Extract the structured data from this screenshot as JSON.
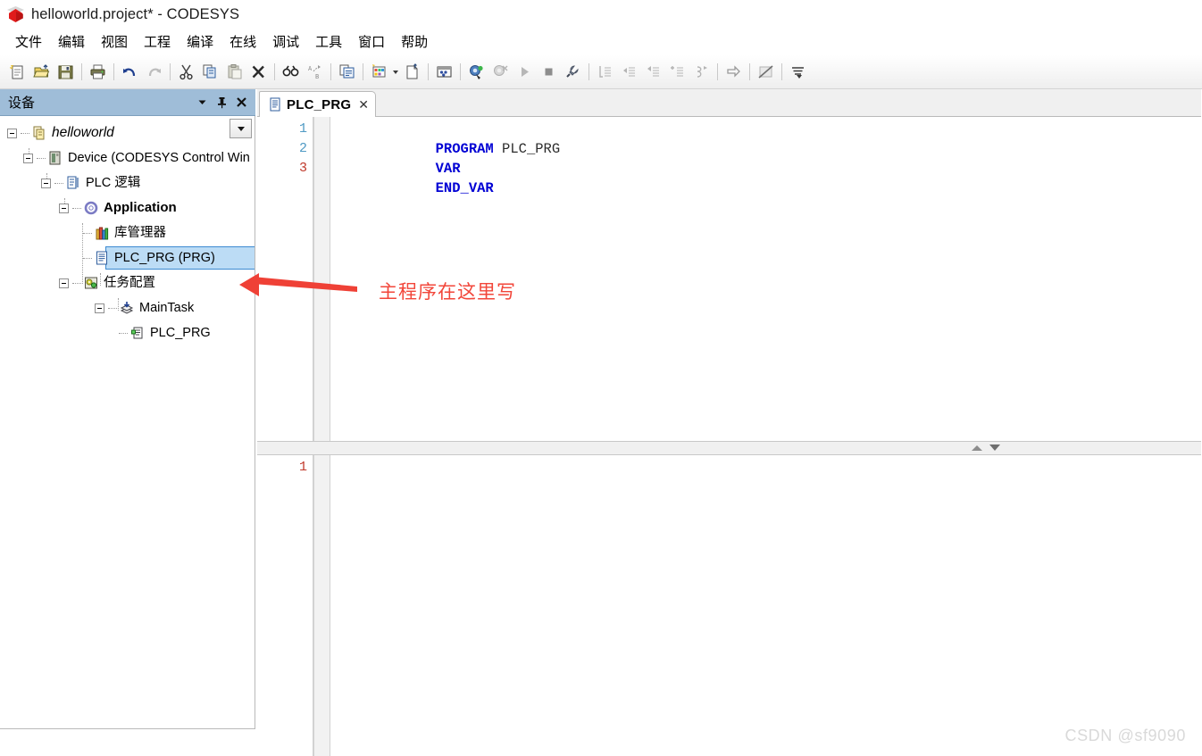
{
  "window": {
    "title": "helloworld.project* - CODESYS",
    "app_icon": "codesys-cube-icon"
  },
  "menubar": {
    "items": [
      {
        "label": "文件",
        "name": "menu-file"
      },
      {
        "label": "编辑",
        "name": "menu-edit"
      },
      {
        "label": "视图",
        "name": "menu-view"
      },
      {
        "label": "工程",
        "name": "menu-project"
      },
      {
        "label": "编译",
        "name": "menu-build"
      },
      {
        "label": "在线",
        "name": "menu-online"
      },
      {
        "label": "调试",
        "name": "menu-debug"
      },
      {
        "label": "工具",
        "name": "menu-tools"
      },
      {
        "label": "窗口",
        "name": "menu-window"
      },
      {
        "label": "帮助",
        "name": "menu-help"
      }
    ]
  },
  "toolbar": {
    "buttons": [
      "new-project-icon",
      "open-project-icon",
      "save-project-icon",
      "print-icon",
      "undo-icon",
      "redo-icon",
      "cut-icon",
      "copy-icon",
      "paste-icon",
      "delete-icon",
      "find-icon",
      "replace-icon",
      "properties-icon",
      "new-object-icon",
      "new-object-dropdown-icon",
      "new-folder-icon",
      "device-repository-icon",
      "library-repository-icon",
      "login-icon",
      "logout-icon",
      "start-icon",
      "stop-icon",
      "build-icon",
      "step-into-icon",
      "step-over-icon",
      "step-out-icon",
      "run-to-cursor-icon",
      "set-next-statement-icon",
      "show-next-statement-icon",
      "toggle-breakpoint-icon",
      "write-values-icon"
    ]
  },
  "devices_panel": {
    "title": "设备",
    "header_buttons": [
      "panel-menu-icon",
      "pin-icon",
      "close-icon"
    ],
    "dropdown_button": "tree-options-dropdown-icon",
    "tree": [
      {
        "label": "helloworld",
        "style": "italic",
        "indent": 0,
        "icon": "project-icon",
        "expander": "collapse",
        "name": "tree-item-project"
      },
      {
        "label": "Device (CODESYS Control Win",
        "style": "normal",
        "indent": 1,
        "icon": "device-icon",
        "expander": "collapse",
        "name": "tree-item-device"
      },
      {
        "label": "PLC 逻辑",
        "style": "normal",
        "indent": 2,
        "icon": "plc-logic-icon",
        "expander": "collapse",
        "name": "tree-item-plc-logic"
      },
      {
        "label": "Application",
        "style": "bold",
        "indent": 3,
        "icon": "application-icon",
        "expander": "collapse",
        "name": "tree-item-application"
      },
      {
        "label": "库管理器",
        "style": "normal",
        "indent": 4,
        "icon": "library-manager-icon",
        "expander": "none",
        "name": "tree-item-library-manager"
      },
      {
        "label": "PLC_PRG (PRG)",
        "style": "normal",
        "indent": 4,
        "icon": "pou-prg-icon",
        "expander": "none",
        "selected": true,
        "name": "tree-item-plc-prg"
      },
      {
        "label": "任务配置",
        "style": "normal",
        "indent": 3,
        "icon": "task-configuration-icon",
        "expander": "collapse",
        "name": "tree-item-task-configuration"
      },
      {
        "label": "MainTask",
        "style": "normal",
        "indent": 4,
        "icon": "task-icon",
        "expander": "collapse",
        "name": "tree-item-maintask"
      },
      {
        "label": "PLC_PRG",
        "style": "normal",
        "indent": 5,
        "icon": "task-call-icon",
        "expander": "none",
        "name": "tree-item-maintask-plc-prg"
      }
    ]
  },
  "editor": {
    "tab": {
      "label": "PLC_PRG",
      "icon": "pou-prg-icon",
      "close_label": "✕"
    },
    "declaration": {
      "line_numbers": [
        "1",
        "2",
        "3"
      ],
      "line_number_colors": [
        "#4f9ac4",
        "#4f9ac4",
        "#c0392b"
      ],
      "lines": [
        {
          "keyword": "PROGRAM",
          "rest": " PLC_PRG"
        },
        {
          "keyword": "VAR",
          "rest": ""
        },
        {
          "keyword": "END_VAR",
          "rest": ""
        }
      ]
    },
    "implementation": {
      "line_numbers": [
        "1"
      ],
      "line_number_colors": [
        "#c0392b"
      ],
      "lines": []
    },
    "splitter": {
      "up_arrow": "scroll-up-icon",
      "down_arrow": "scroll-down-icon"
    }
  },
  "annotation": {
    "text": "主程序在这里写",
    "color": "#f2463a",
    "arrow": "left-pointing-arrow"
  },
  "watermark": {
    "text": "CSDN @sf9090"
  },
  "colors": {
    "panel_header": "#9fbdd8",
    "selection": "#bcdcf5",
    "selection_border": "#3c8ad1",
    "keyword": "#0000d4",
    "annotation": "#f2463a"
  }
}
